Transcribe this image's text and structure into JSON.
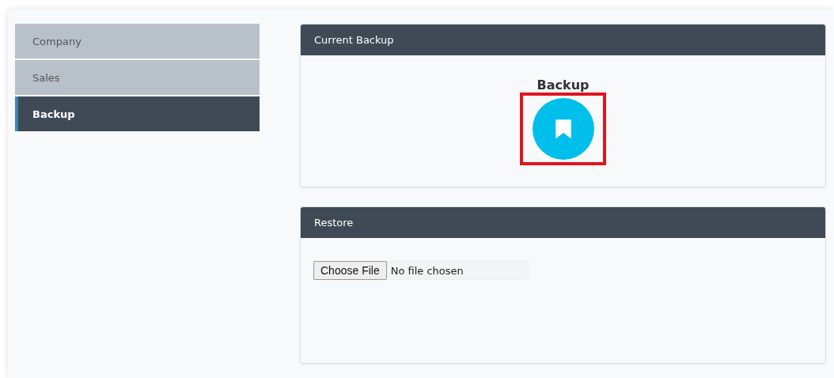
{
  "sidebar": {
    "items": [
      {
        "label": "Company",
        "selected": false
      },
      {
        "label": "Sales",
        "selected": false
      },
      {
        "label": "Backup",
        "selected": true
      }
    ]
  },
  "current_backup": {
    "title": "Current Backup",
    "action_label": "Backup"
  },
  "restore": {
    "title": "Restore",
    "file_button": "Choose File",
    "file_status": "No file chosen"
  }
}
